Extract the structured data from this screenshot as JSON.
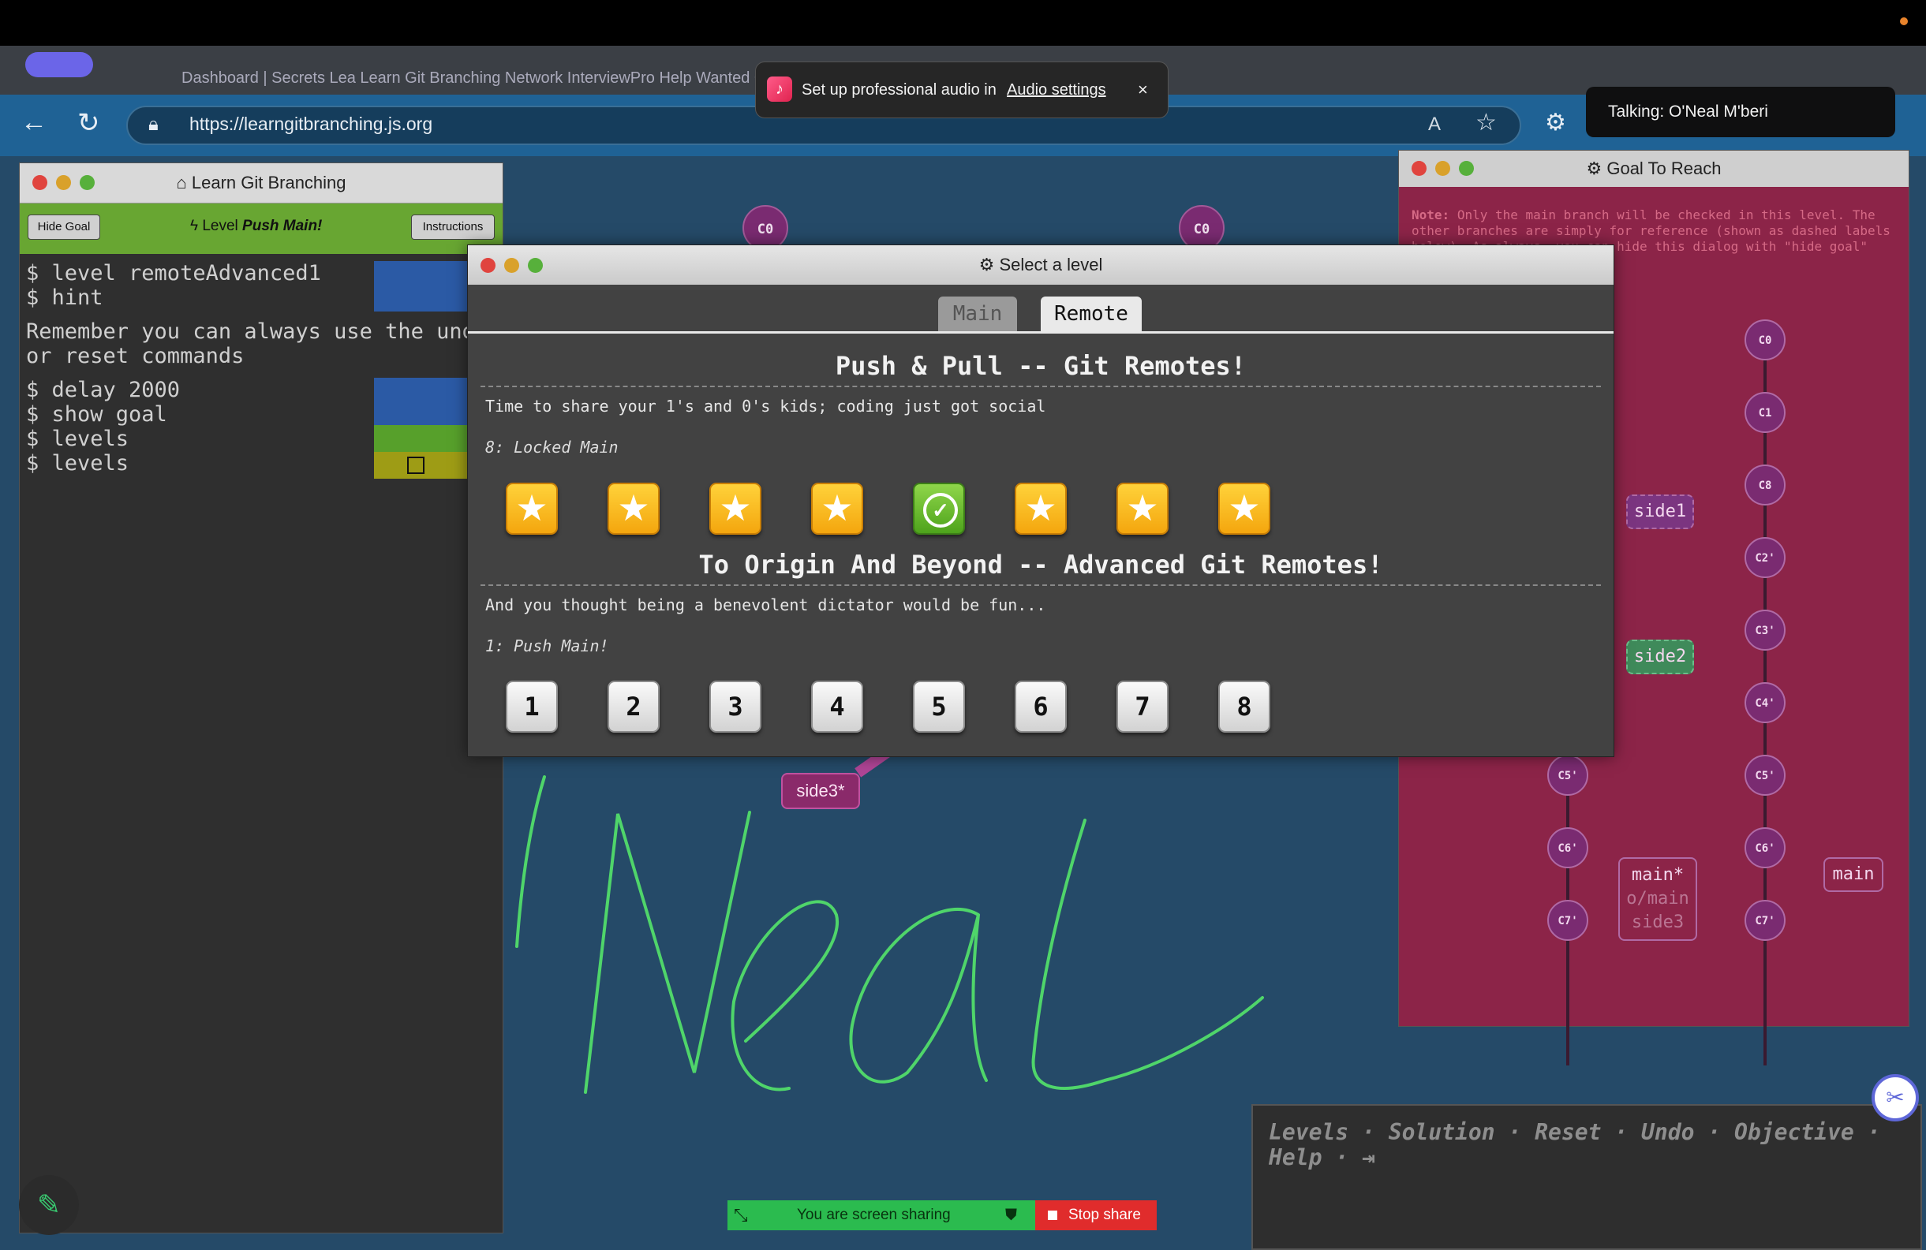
{
  "browser": {
    "url": "https://learngitbranching.js.org",
    "tabs_ghost": "Dashboard | Secrets Lea        Learn Git Branching                                        Network          InterviewPro Help Wanted        Google Security - Nice Pacer"
  },
  "toast": {
    "text": "Set up professional audio in",
    "link": "Audio settings",
    "close": "×"
  },
  "talking": "Talking: O'Neal M'beri",
  "terminal": {
    "title": "Learn Git Branching",
    "hide_goal": "Hide Goal",
    "level_prefix": "Level",
    "level_name": "Push Main!",
    "instructions": "Instructions",
    "lines": [
      "$ level remoteAdvanced1",
      "$ hint",
      "Remember you can always use the undo",
      "or reset commands",
      "$ delay 2000",
      "$ show goal",
      "$ levels",
      "$ levels"
    ]
  },
  "canvas": {
    "c0_a": "C0",
    "c0_b": "C0",
    "side3": "side3*"
  },
  "goal": {
    "title": "Goal To Reach",
    "note_label": "Note:",
    "note_text": "Only the main branch will be checked in this level. The other branches are simply for reference (shown as dashed labels below). As always, you can hide this dialog with \"hide goal\"",
    "right_commits": [
      "C0",
      "C1",
      "C8",
      "C2'",
      "C3'",
      "C4'",
      "C5'",
      "C6'",
      "C7'"
    ],
    "left_commits": [
      "C5'",
      "C6'",
      "C7'"
    ],
    "side1": "side1",
    "side2": "side2",
    "main_stack": [
      "main*",
      "o/main",
      "side3"
    ],
    "main": "main"
  },
  "dialog": {
    "title": "Select a level",
    "tab_main": "Main",
    "tab_remote": "Remote",
    "sec1_title": "Push & Pull -- Git Remotes!",
    "sec1_desc": "Time to share your 1's and 0's kids; coding just got social",
    "sec1_selected": "8: Locked Main",
    "sec2_title": "To Origin And Beyond -- Advanced Git Remotes!",
    "sec2_desc": "And you thought being a benevolent dictator would be fun...",
    "sec2_selected": "1: Push Main!",
    "sec2_levels": [
      "1",
      "2",
      "3",
      "4",
      "5",
      "6",
      "7",
      "8"
    ]
  },
  "command_bar": {
    "text": "Levels · Solution · Reset · Undo · Objective · Help ·"
  },
  "share": {
    "sharing": "You are screen sharing",
    "stop": "Stop share"
  },
  "colors": {
    "accent_green": "#2bbb4f",
    "stop_red": "#e02c2c",
    "goal_bg": "#8c2448",
    "canvas_bg": "#254a68"
  }
}
